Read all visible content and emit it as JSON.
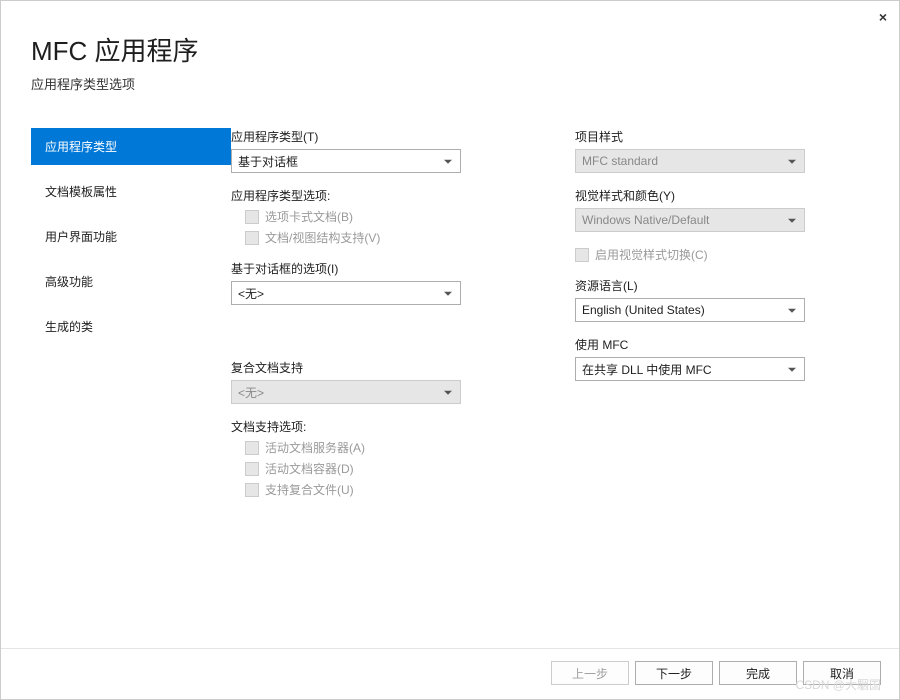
{
  "header": {
    "title": "MFC 应用程序",
    "subtitle": "应用程序类型选项"
  },
  "close_label": "×",
  "sidebar": {
    "items": [
      {
        "label": "应用程序类型",
        "active": true
      },
      {
        "label": "文档模板属性",
        "active": false
      },
      {
        "label": "用户界面功能",
        "active": false
      },
      {
        "label": "高级功能",
        "active": false
      },
      {
        "label": "生成的类",
        "active": false
      }
    ]
  },
  "left_col": {
    "app_type": {
      "label": "应用程序类型(T)",
      "value": "基于对话框"
    },
    "app_type_options_label": "应用程序类型选项:",
    "opt_tabbed": {
      "label": "选项卡式文档(B)",
      "checked": false,
      "enabled": false
    },
    "opt_docview": {
      "label": "文档/视图结构支持(V)",
      "checked": false,
      "enabled": false
    },
    "dialog_options": {
      "label": "基于对话框的选项(I)",
      "value": "<无>"
    },
    "compound_support": {
      "label": "复合文档支持",
      "value": "<无>",
      "enabled": false
    },
    "doc_support_label": "文档支持选项:",
    "opt_active_server": {
      "label": "活动文档服务器(A)",
      "checked": false,
      "enabled": false
    },
    "opt_active_container": {
      "label": "活动文档容器(D)",
      "checked": false,
      "enabled": false
    },
    "opt_support_compound": {
      "label": "支持复合文件(U)",
      "checked": false,
      "enabled": false
    }
  },
  "right_col": {
    "project_style": {
      "label": "项目样式",
      "value": "MFC standard",
      "enabled": false
    },
    "visual_style": {
      "label": "视觉样式和颜色(Y)",
      "value": "Windows Native/Default",
      "enabled": false
    },
    "enable_visual_switch": {
      "label": "启用视觉样式切换(C)",
      "checked": false,
      "enabled": false
    },
    "resource_lang": {
      "label": "资源语言(L)",
      "value": "English (United States)"
    },
    "use_mfc": {
      "label": "使用 MFC",
      "value": "在共享 DLL 中使用 MFC"
    }
  },
  "footer": {
    "prev": "上一步",
    "next": "下一步",
    "finish": "完成",
    "cancel": "取消"
  },
  "watermark": "CSDN @大駰国"
}
